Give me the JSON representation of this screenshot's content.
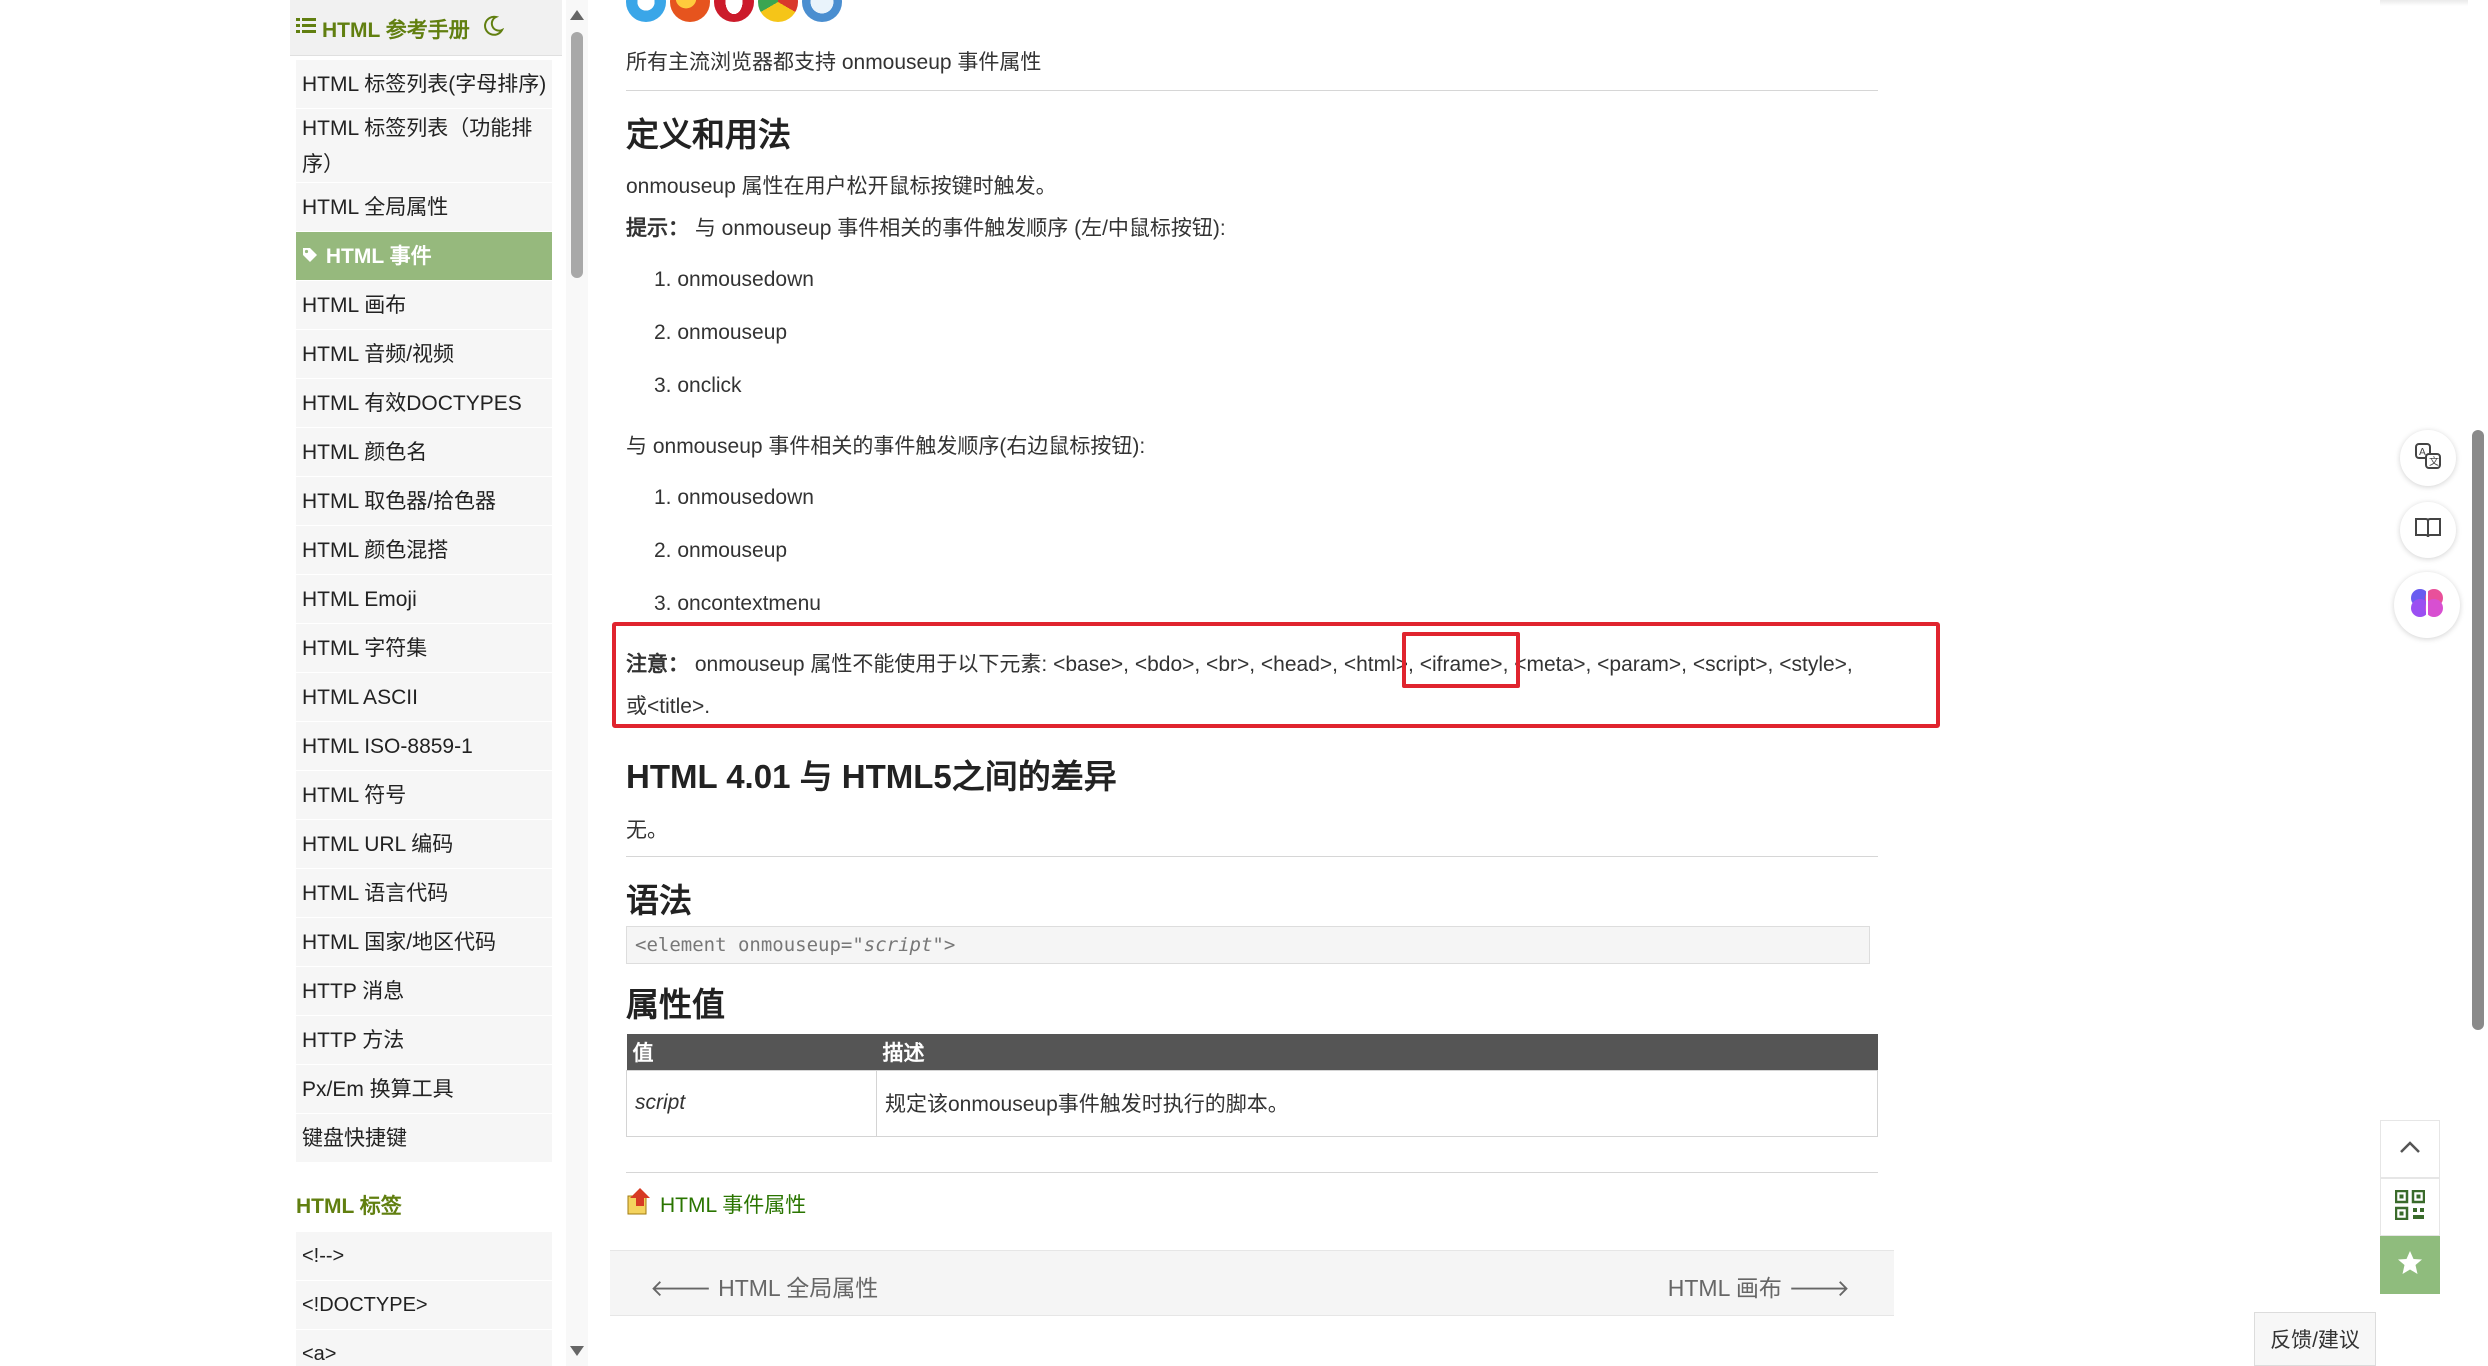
{
  "sidebar": {
    "header_title": "HTML 参考手册",
    "items": [
      {
        "label": "HTML 标签列表(字母排序)"
      },
      {
        "label": "HTML 标签列表（功能排序）"
      },
      {
        "label": "HTML 全局属性"
      },
      {
        "label": "HTML 事件",
        "active": true
      },
      {
        "label": "HTML 画布"
      },
      {
        "label": "HTML 音频/视频"
      },
      {
        "label": "HTML 有效DOCTYPES"
      },
      {
        "label": "HTML 颜色名"
      },
      {
        "label": "HTML 取色器/拾色器"
      },
      {
        "label": "HTML 颜色混搭"
      },
      {
        "label": "HTML Emoji"
      },
      {
        "label": "HTML 字符集"
      },
      {
        "label": "HTML ASCII"
      },
      {
        "label": "HTML ISO-8859-1"
      },
      {
        "label": "HTML 符号"
      },
      {
        "label": "HTML URL 编码"
      },
      {
        "label": "HTML 语言代码"
      },
      {
        "label": "HTML 国家/地区代码"
      },
      {
        "label": "HTTP 消息"
      },
      {
        "label": "HTTP 方法"
      },
      {
        "label": "Px/Em 换算工具"
      },
      {
        "label": "键盘快捷键"
      }
    ],
    "section_title": "HTML 标签",
    "tags": [
      {
        "label": "<!-->"
      },
      {
        "label": "<!DOCTYPE>"
      },
      {
        "label": "<a>"
      }
    ]
  },
  "main": {
    "support_text": "所有主流浏览器都支持 onmouseup 事件属性",
    "h_definition": "定义和用法",
    "definition": "onmouseup 属性在用户松开鼠标按键时触发。",
    "tip_label": "提示：",
    "tip_text": " 与 onmouseup 事件相关的事件触发顺序 (左/中鼠标按钮):",
    "left_order": [
      "1. onmousedown",
      "2. onmouseup",
      "3. onclick"
    ],
    "right_intro": "与 onmouseup 事件相关的事件触发顺序(右边鼠标按钮):",
    "right_order": [
      "1. onmousedown",
      "2. onmouseup",
      "3. oncontextmenu"
    ],
    "note_label": "注意：",
    "note_text": " onmouseup 属性不能使用于以下元素: <base>, <bdo>, <br>, <head>, <html>, <iframe>, <meta>, <param>, <script>, <style>,",
    "note_text2": "或<title>.",
    "h_diff": "HTML 4.01 与 HTML5之间的差异",
    "diff_text": "无。",
    "h_syntax": "语法",
    "syntax_prefix": "<element onmouseup=\"",
    "syntax_script": "script",
    "syntax_suffix": "\">",
    "h_values": "属性值",
    "table_headers": [
      "值",
      "描述"
    ],
    "table_rows": [
      [
        "script",
        "规定该onmouseup事件触发时执行的脚本。"
      ]
    ],
    "ref_link": "HTML 事件属性",
    "nav_prev": "HTML 全局属性",
    "nav_next": "HTML 画布"
  },
  "feedback_label": "反馈/建议",
  "colors": {
    "accent_green": "#96b97d",
    "link_green": "#617f10",
    "highlight_red": "#e0242e"
  }
}
